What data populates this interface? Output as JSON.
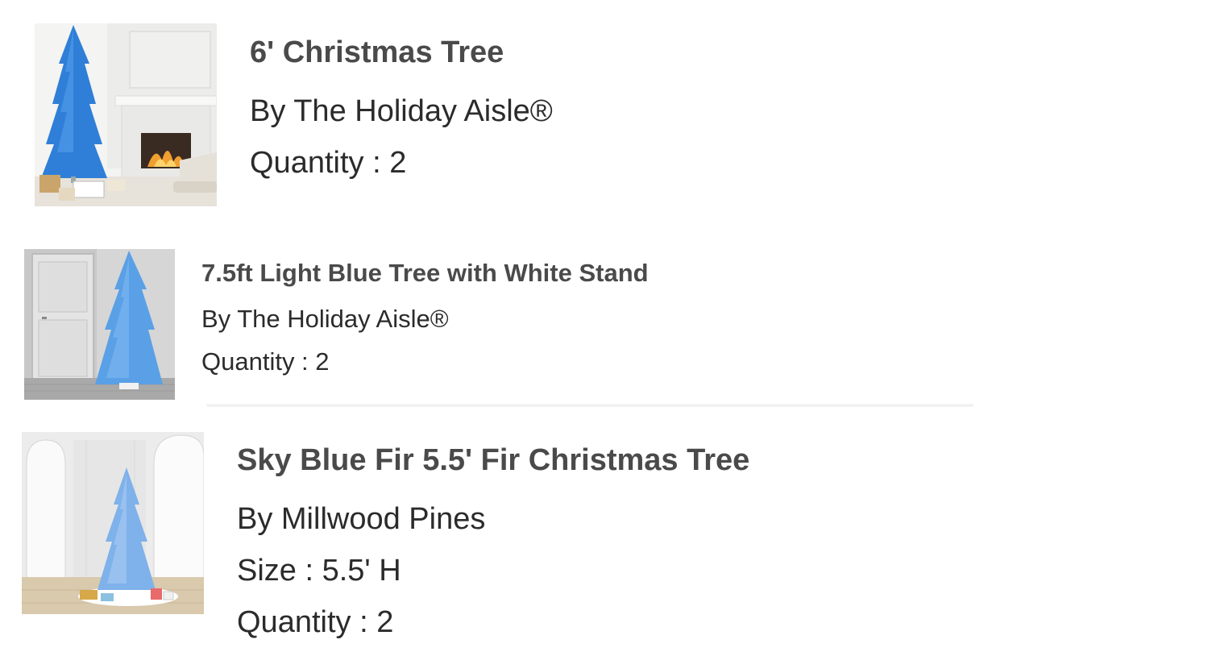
{
  "order_items": [
    {
      "title": "6' Christmas Tree",
      "brand": "By The Holiday Aisle®",
      "quantity": "Quantity : 2",
      "image_icon": "blue-pencil-christmas-tree-fireplace-image"
    },
    {
      "title": "7.5ft Light Blue Tree with White Stand",
      "brand": "By The Holiday Aisle®",
      "quantity": "Quantity : 2",
      "image_icon": "light-blue-christmas-tree-door-image"
    },
    {
      "title": "Sky Blue Fir 5.5' Fir Christmas Tree",
      "brand": "By Millwood Pines",
      "size": "Size : 5.5' H",
      "quantity": "Quantity : 2",
      "image_icon": "sky-blue-fir-tree-room-image"
    }
  ],
  "colors": {
    "title_text": "#4a4a4a",
    "body_text": "#2b2b2b",
    "tree_blue": "#2f7fd8",
    "light_tree_blue": "#5aa0e6",
    "sky_tree_blue": "#7fb1ea",
    "divider": "#f2f2f2"
  }
}
